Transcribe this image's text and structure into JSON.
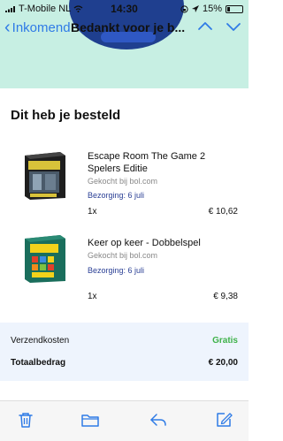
{
  "status_bar": {
    "carrier": "T-Mobile NL",
    "time": "14:30",
    "battery": "15%"
  },
  "nav": {
    "back_label": "Inkomend",
    "title": "Bedankt voor je b..."
  },
  "order": {
    "heading": "Dit heb je besteld",
    "items": [
      {
        "name": "Escape Room The Game 2 Spelers Editie",
        "shop": "Gekocht bij bol.com",
        "delivery": "Bezorging: 6 juli",
        "quantity": "1x",
        "price": "€ 10,62"
      },
      {
        "name": "Keer op keer - Dobbelspel",
        "shop": "Gekocht bij bol.com",
        "delivery": "Bezorging: 6 juli",
        "quantity": "1x",
        "price": "€ 9,38"
      }
    ]
  },
  "totals": {
    "shipping_label": "Verzendkosten",
    "shipping_value": "Gratis",
    "total_label": "Totaalbedrag",
    "total_value": "€ 20,00"
  },
  "colors": {
    "accent": "#2f7be6",
    "header_bg": "#c7efe3",
    "free": "#3fb24a",
    "delivery": "#2a3f95",
    "totals_bg": "#eef4fd"
  },
  "toolbar": {
    "icons": [
      "trash-icon",
      "folder-icon",
      "reply-icon",
      "compose-icon"
    ]
  }
}
